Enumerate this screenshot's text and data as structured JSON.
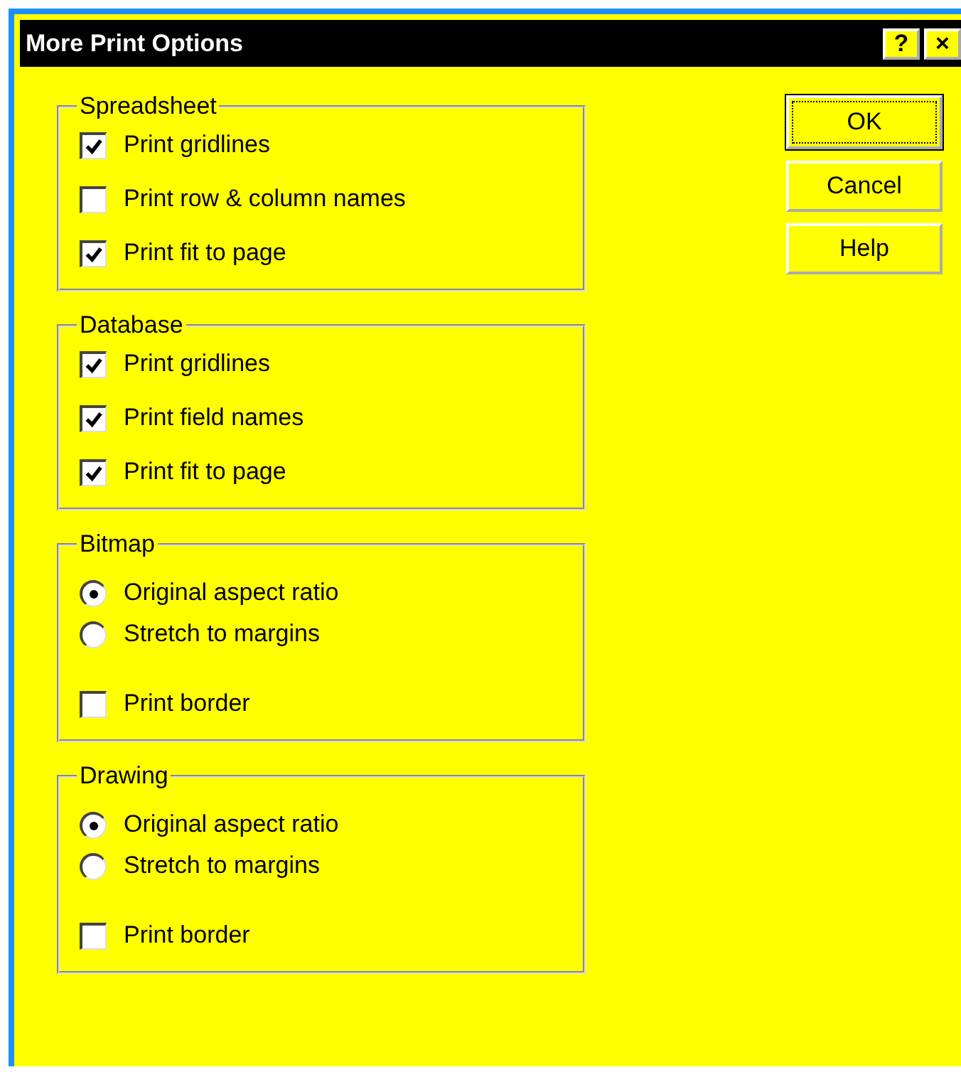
{
  "window": {
    "title": "More Print Options",
    "title_buttons": [
      "?",
      "×"
    ]
  },
  "groups": [
    {
      "title": "Spreadsheet",
      "items": [
        {
          "kind": "checkbox",
          "label": "Print gridlines",
          "checked": true
        },
        {
          "kind": "checkbox",
          "label": "Print row & column names",
          "checked": false
        },
        {
          "kind": "checkbox",
          "label": "Print fit to page",
          "checked": true
        }
      ]
    },
    {
      "title": "Database",
      "items": [
        {
          "kind": "checkbox",
          "label": "Print gridlines",
          "checked": true
        },
        {
          "kind": "checkbox",
          "label": "Print field names",
          "checked": true
        },
        {
          "kind": "checkbox",
          "label": "Print fit to page",
          "checked": true
        }
      ]
    },
    {
      "title": "Bitmap",
      "items": [
        {
          "kind": "radio",
          "label": "Original aspect ratio",
          "selected": true
        },
        {
          "kind": "radio",
          "label": "Stretch to margins",
          "selected": false
        },
        {
          "kind": "checkbox",
          "label": "Print border",
          "checked": false
        }
      ]
    },
    {
      "title": "Drawing",
      "items": [
        {
          "kind": "radio",
          "label": "Original aspect ratio",
          "selected": true
        },
        {
          "kind": "radio",
          "label": "Stretch to margins",
          "selected": false
        },
        {
          "kind": "checkbox",
          "label": "Print border",
          "checked": false
        }
      ]
    }
  ],
  "buttons": [
    {
      "label": "OK",
      "default": true
    },
    {
      "label": "Cancel",
      "default": false
    },
    {
      "label": "Help",
      "default": false
    }
  ]
}
